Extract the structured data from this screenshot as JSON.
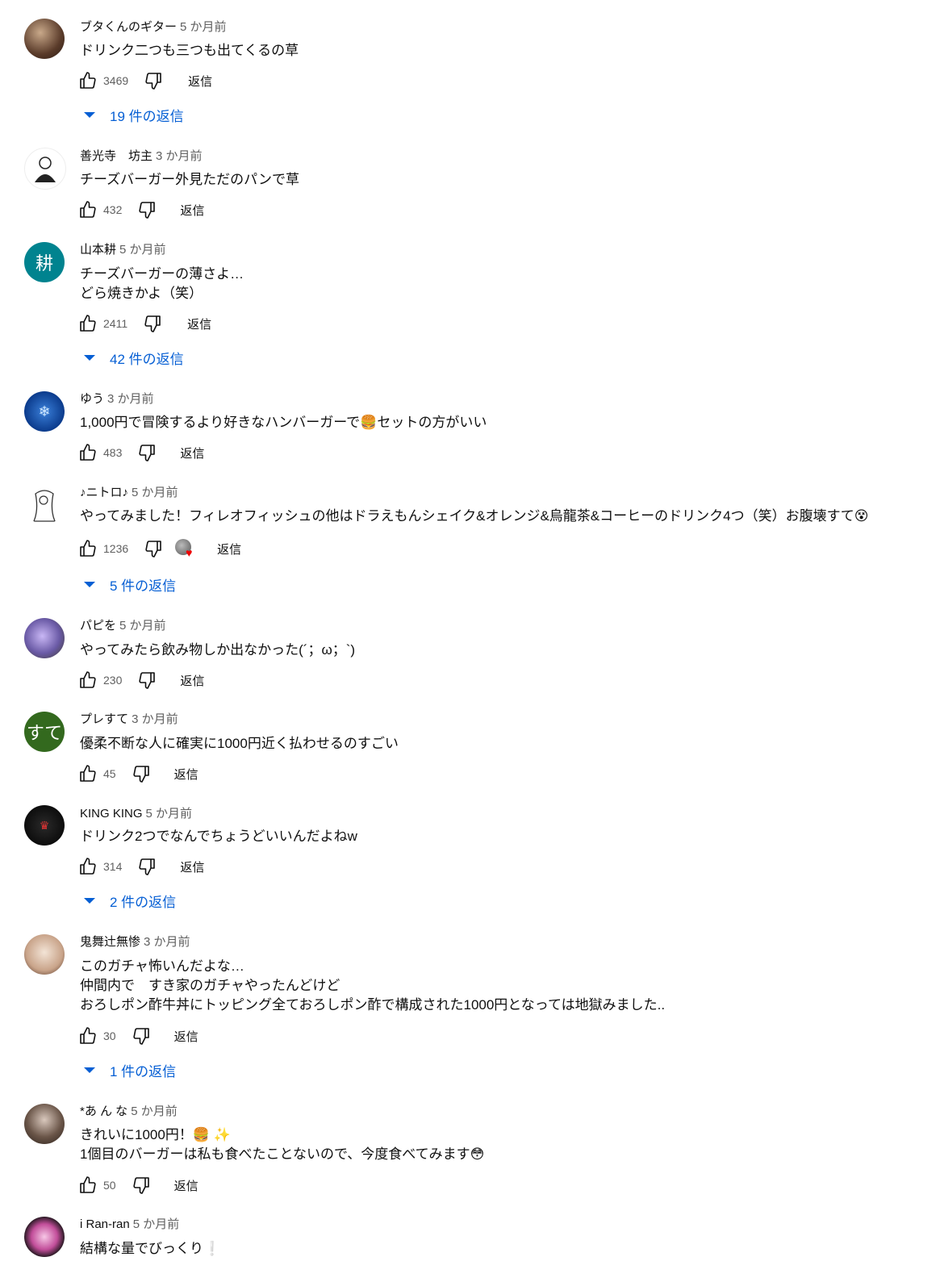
{
  "comments": [
    {
      "author": "ブタくんのギター",
      "time": "5 か月前",
      "lines": [
        "ドリンク二つも三つも出てくるの草"
      ],
      "likes": "3469",
      "reply_label": "返信",
      "replies": "19 件の返信"
    },
    {
      "author": "善光寺　坊主",
      "time": "3 か月前",
      "lines": [
        "チーズバーガー外見ただのパンで草"
      ],
      "likes": "432",
      "reply_label": "返信"
    },
    {
      "author": "山本耕",
      "time": "5 か月前",
      "avatar_letter": "耕",
      "lines": [
        "チーズバーガーの薄さよ…",
        "どら焼きかよ（笑）"
      ],
      "likes": "2411",
      "reply_label": "返信",
      "replies": "42 件の返信"
    },
    {
      "author": "ゆう",
      "time": "3 か月前",
      "lines": [
        "1,000円で冒険するより好きなハンバーガーで🍔セットの方がいい"
      ],
      "likes": "483",
      "reply_label": "返信"
    },
    {
      "author": "♪ニトロ♪",
      "time": "5 か月前",
      "lines": [
        "やってみました！フィレオフィッシュの他はドラえもんシェイク&オレンジ&烏龍茶&コーヒーのドリンク4つ（笑）お腹壊すて😵"
      ],
      "likes": "1236",
      "reply_label": "返信",
      "replies": "5 件の返信"
    },
    {
      "author": "パピを",
      "time": "5 か月前",
      "lines": [
        "やってみたら飲み物しか出なかった(´；ω；`)"
      ],
      "likes": "230",
      "reply_label": "返信"
    },
    {
      "author": "プレすて",
      "time": "3 か月前",
      "avatar_letter": "すて",
      "lines": [
        "優柔不断な人に確実に1000円近く払わせるのすごい"
      ],
      "likes": "45",
      "reply_label": "返信"
    },
    {
      "author": "KING KING",
      "time": "5 か月前",
      "lines": [
        "ドリンク2つでなんでちょうどいいんだよねw"
      ],
      "likes": "314",
      "reply_label": "返信",
      "replies": "2 件の返信"
    },
    {
      "author": "鬼舞辻無惨",
      "time": "3 か月前",
      "lines": [
        "このガチャ怖いんだよな…",
        "仲間内で　すき家のガチャやったんどけど",
        "おろしポン酢牛丼にトッピング全ておろしポン酢で構成された1000円となっては地獄みました.."
      ],
      "likes": "30",
      "reply_label": "返信",
      "replies": "1 件の返信"
    },
    {
      "author": "*あ ん な",
      "time": "5 か月前",
      "lines": [
        "きれいに1000円！🍔 ✨",
        "1個目のバーガーは私も食べたことないので、今度食べてみます😳"
      ],
      "likes": "50",
      "reply_label": "返信"
    },
    {
      "author": "i Ran-ran",
      "time": "5 か月前",
      "lines": [
        "結構な量でびっくり❕"
      ]
    }
  ],
  "colors": {
    "link": "#065fd4",
    "meta": "#606060",
    "avatar_teal": "#00838f",
    "avatar_green": "#33691e"
  }
}
